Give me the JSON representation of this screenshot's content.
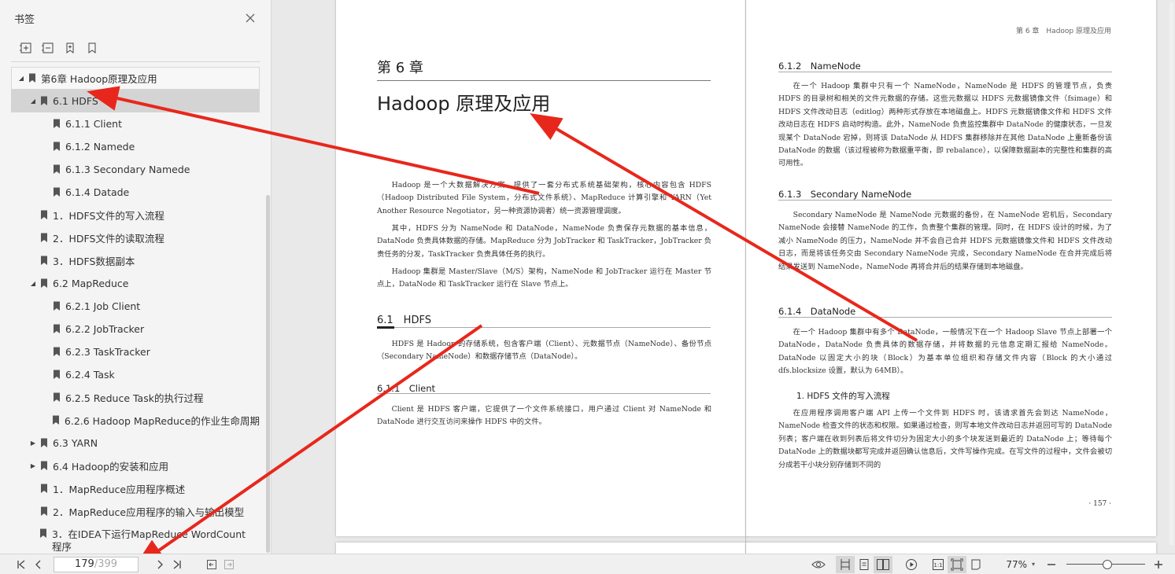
{
  "sidebar": {
    "title": "书签",
    "items": [
      {
        "label": "第6章 Hadoop原理及应用",
        "level": 0,
        "toggle": "expanded",
        "name": "bookmark-chapter-6"
      },
      {
        "label": "6.1 HDFS",
        "level": 1,
        "toggle": "expanded",
        "name": "bookmark-6-1-hdfs"
      },
      {
        "label": "6.1.1 Client",
        "level": 2,
        "toggle": "none",
        "name": "bookmark-6-1-1"
      },
      {
        "label": "6.1.2 Namede",
        "level": 2,
        "toggle": "none",
        "name": "bookmark-6-1-2"
      },
      {
        "label": "6.1.3 Secondary Namede",
        "level": 2,
        "toggle": "none",
        "name": "bookmark-6-1-3"
      },
      {
        "label": "6.1.4 Datade",
        "level": 2,
        "toggle": "none",
        "name": "bookmark-6-1-4"
      },
      {
        "label": "1．HDFS文件的写入流程",
        "level": 1,
        "toggle": "none",
        "name": "bookmark-hdfs-write"
      },
      {
        "label": "2．HDFS文件的读取流程",
        "level": 1,
        "toggle": "none",
        "name": "bookmark-hdfs-read"
      },
      {
        "label": "3．HDFS数据副本",
        "level": 1,
        "toggle": "none",
        "name": "bookmark-hdfs-replica"
      },
      {
        "label": "6.2 MapReduce",
        "level": 1,
        "toggle": "expanded",
        "name": "bookmark-6-2"
      },
      {
        "label": "6.2.1 Job Client",
        "level": 2,
        "toggle": "none",
        "name": "bookmark-6-2-1"
      },
      {
        "label": "6.2.2 JobTracker",
        "level": 2,
        "toggle": "none",
        "name": "bookmark-6-2-2"
      },
      {
        "label": "6.2.3 TaskTracker",
        "level": 2,
        "toggle": "none",
        "name": "bookmark-6-2-3"
      },
      {
        "label": "6.2.4 Task",
        "level": 2,
        "toggle": "none",
        "name": "bookmark-6-2-4"
      },
      {
        "label": "6.2.5 Reduce Task的执行过程",
        "level": 2,
        "toggle": "none",
        "name": "bookmark-6-2-5"
      },
      {
        "label": "6.2.6 Hadoop MapReduce的作业生命周期",
        "level": 2,
        "toggle": "none",
        "name": "bookmark-6-2-6"
      },
      {
        "label": "6.3 YARN",
        "level": 1,
        "toggle": "collapsed",
        "name": "bookmark-6-3"
      },
      {
        "label": "6.4 Hadoop的安装和应用",
        "level": 1,
        "toggle": "collapsed",
        "name": "bookmark-6-4"
      },
      {
        "label": "1．MapReduce应用程序概述",
        "level": 1,
        "toggle": "none",
        "name": "bookmark-mr-overview"
      },
      {
        "label": "2．MapReduce应用程序的输入与输出模型",
        "level": 1,
        "toggle": "none",
        "name": "bookmark-mr-io"
      },
      {
        "label": "3．在IDEA下运行MapReduce WordCount程序",
        "level": 1,
        "toggle": "none",
        "name": "bookmark-idea-wordcount"
      }
    ]
  },
  "left_page": {
    "chapter": "第 6 章",
    "title": "Hadoop 原理及应用",
    "intro1": "Hadoop 是一个大数据解决方案，提供了一套分布式系统基础架构，核心内容包含 HDFS（Hadoop Distributed File System，分布式文件系统）、MapReduce 计算引擎和 YARN（Yet Another Resource Negotiator，另一种资源协调者）统一资源管理调度。",
    "intro2": "其中，HDFS 分为 NameNode 和 DataNode，NameNode 负责保存元数据的基本信息，DataNode 负责具体数据的存储。MapReduce 分为 JobTracker 和 TaskTracker，JobTracker 负责任务的分发，TaskTracker 负责具体任务的执行。",
    "intro3": "Hadoop 集群是 Master/Slave（M/S）架构，NameNode 和 JobTracker 运行在 Master 节点上，DataNode 和 TaskTracker 运行在 Slave 节点上。",
    "sec61": "6.1　HDFS",
    "sec61_text": "HDFS 是 Hadoop 的存储系统，包含客户端（Client）、元数据节点（NameNode）、备份节点（Secondary NameNode）和数据存储节点（DataNode）。",
    "sec611": "6.1.1　Client",
    "sec611_text": "Client 是 HDFS 客户端，它提供了一个文件系统接口，用户通过 Client 对 NameNode 和 DataNode 进行交互访问来操作 HDFS 中的文件。"
  },
  "right_page": {
    "running_head": "第 6 章　Hadoop 原理及应用",
    "sec612": "6.1.2　NameNode",
    "sec612_text": "在一个 Hadoop 集群中只有一个 NameNode，NameNode 是 HDFS 的管理节点，负责 HDFS 的目录树和相关的文件元数据的存储。这些元数据以 HDFS 元数据镜像文件（fsimage）和 HDFS 文件改动日志（editlog）两种形式存放在本地磁盘上。HDFS 元数据镜像文件和 HDFS 文件改动日志在 HDFS 启动时构造。此外，NameNode 负责监控集群中 DataNode 的健康状态，一旦发现某个 DataNode 宕掉，则将该 DataNode 从 HDFS 集群移除并在其他 DataNode 上重新备份该 DataNode 的数据（该过程被称为数据重平衡，即 rebalance），以保障数据副本的完整性和集群的高可用性。",
    "sec613": "6.1.3　Secondary NameNode",
    "sec613_text": "Secondary NameNode 是 NameNode 元数据的备份，在 NameNode 宕机后，Secondary NameNode 会接替 NameNode 的工作，负责整个集群的管理。同时，在 HDFS 设计的时候，为了减小 NameNode 的压力，NameNode 并不会自己合并 HDFS 元数据镜像文件和 HDFS 文件改动日志，而是将该任务交由 Secondary NameNode 完成，Secondary NameNode 在合并完成后将结果发送到 NameNode，NameNode 再将合并后的结果存储到本地磁盘。",
    "sec614": "6.1.4　DataNode",
    "sec614_text": "在一个 Hadoop 集群中有多个 DataNode，一般情况下在一个 Hadoop Slave 节点上部署一个 DataNode，DataNode 负责具体的数据存储，并将数据的元信息定期汇报给 NameNode。DataNode 以固定大小的块（Block）为基本单位组织和存储文件内容（Block 的大小通过 dfs.blocksize 设置，默认为 64MB）。",
    "sub1": "1. HDFS 文件的写入流程",
    "sub1_text": "在应用程序调用客户端 API 上传一个文件到 HDFS 时，该请求首先会到达 NameNode，NameNode 检查文件的状态和权限。如果通过检查，则写本地文件改动日志并返回可写的 DataNode 列表；客户端在收到列表后将文件切分为固定大小的多个块发送到最近的 DataNode 上；等待每个 DataNode 上的数据块都写完成并返回确认信息后，文件写操作完成。在写文件的过程中，文件会被切分成若干小块分别存储到不同的",
    "page_number": "· 157 ·"
  },
  "statusbar": {
    "current_page": "179",
    "total_pages": "/399",
    "zoom": "77%",
    "zoom_fraction": 0.52
  },
  "colors": {
    "annotation_arrow": "#e8271c",
    "selected_bookmark": "#d4d4d4"
  }
}
